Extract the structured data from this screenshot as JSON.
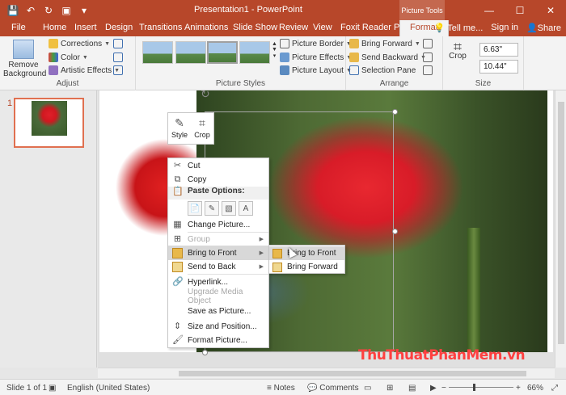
{
  "window": {
    "title": "Presentation1 - PowerPoint",
    "context_tab": "Picture Tools",
    "minimize": "—",
    "restore": "☐",
    "close": "✕"
  },
  "qat": {
    "save": "💾",
    "undo": "↶",
    "redo": "↻",
    "present": "▣",
    "more": "▾"
  },
  "tabs": {
    "file": "File",
    "home": "Home",
    "insert": "Insert",
    "design": "Design",
    "transitions": "Transitions",
    "animations": "Animations",
    "slideshow": "Slide Show",
    "review": "Review",
    "view": "View",
    "foxit": "Foxit Reader PDF",
    "format": "Format",
    "tellme": "Tell me...",
    "signin": "Sign in",
    "share": "Share"
  },
  "ribbon": {
    "adjust": {
      "label": "Adjust",
      "remove_bg": "Remove Background",
      "corrections": "Corrections",
      "color": "Color",
      "artistic": "Artistic Effects"
    },
    "styles": {
      "label": "Picture Styles",
      "border": "Picture Border",
      "effects": "Picture Effects",
      "layout": "Picture Layout"
    },
    "arrange": {
      "label": "Arrange",
      "bring_forward": "Bring Forward",
      "send_backward": "Send Backward",
      "selection_pane": "Selection Pane",
      "crop": "Crop"
    },
    "size": {
      "label": "Size",
      "height": "6.63\"",
      "width": "10.44\""
    }
  },
  "thumbnails": {
    "slide_number": "1"
  },
  "mini_toolbar": {
    "style": "Style",
    "crop": "Crop"
  },
  "context_menu": {
    "cut": "Cut",
    "copy": "Copy",
    "paste_options": "Paste Options:",
    "change_picture": "Change Picture...",
    "group": "Group",
    "bring_to_front": "Bring to Front",
    "send_to_back": "Send to Back",
    "hyperlink": "Hyperlink...",
    "upgrade_media": "Upgrade Media Object",
    "save_as_picture": "Save as Picture...",
    "size_position": "Size and Position...",
    "format_picture": "Format Picture..."
  },
  "submenu": {
    "bring_to_front": "Bring to Front",
    "bring_forward": "Bring Forward"
  },
  "watermark": "ThuThuatPhanMem.vn",
  "status": {
    "slide": "Slide 1 of 1",
    "language": "English (United States)",
    "notes": "Notes",
    "comments": "Comments",
    "zoom": "66%"
  }
}
